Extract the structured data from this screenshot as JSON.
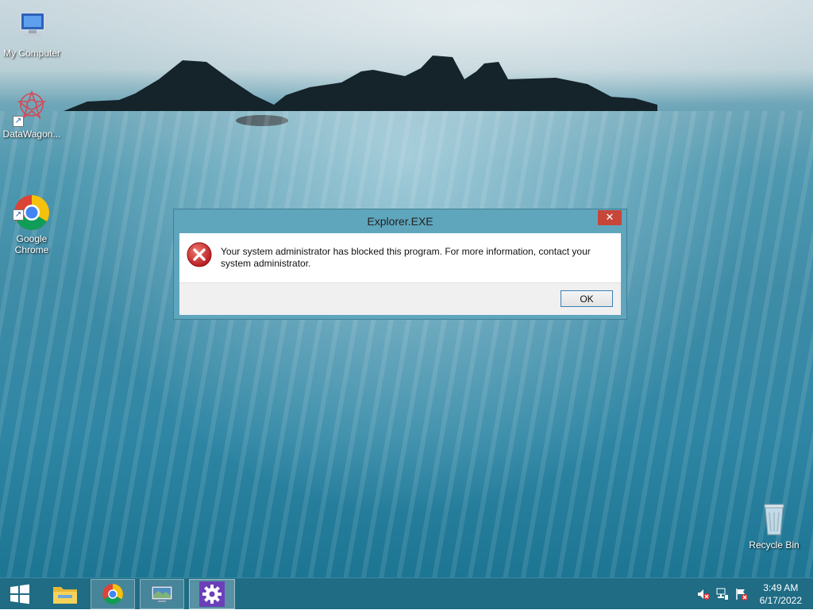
{
  "desktop": {
    "icons": [
      {
        "label": "My Computer",
        "icon": "my-computer-icon"
      },
      {
        "label": "DataWagon...",
        "icon": "datawagon-icon"
      },
      {
        "label": "Google\nChrome",
        "icon": "chrome-icon"
      },
      {
        "label": "Recycle Bin",
        "icon": "recycle-bin-icon"
      }
    ]
  },
  "dialog": {
    "title": "Explorer.EXE",
    "close_glyph": "✕",
    "message": "Your system administrator has blocked this program. For more information, contact your system administrator.",
    "ok_label": "OK",
    "icon": "error-icon"
  },
  "taskbar": {
    "items": [
      {
        "name": "start",
        "icon": "windows-logo-icon"
      },
      {
        "name": "file-explorer",
        "icon": "folder-icon"
      },
      {
        "name": "chrome",
        "icon": "chrome-icon"
      },
      {
        "name": "remote-desktop",
        "icon": "remote-desktop-icon"
      },
      {
        "name": "settings",
        "icon": "gear-icon"
      }
    ],
    "tray": {
      "icons": [
        "volume-muted-icon",
        "network-icon",
        "action-center-flag-icon"
      ],
      "time": "3:49 AM",
      "date": "6/17/2022"
    }
  },
  "colors": {
    "titlebar": "#5fa6bd",
    "close_button": "#c7463a",
    "taskbar": "#1f6c84"
  }
}
